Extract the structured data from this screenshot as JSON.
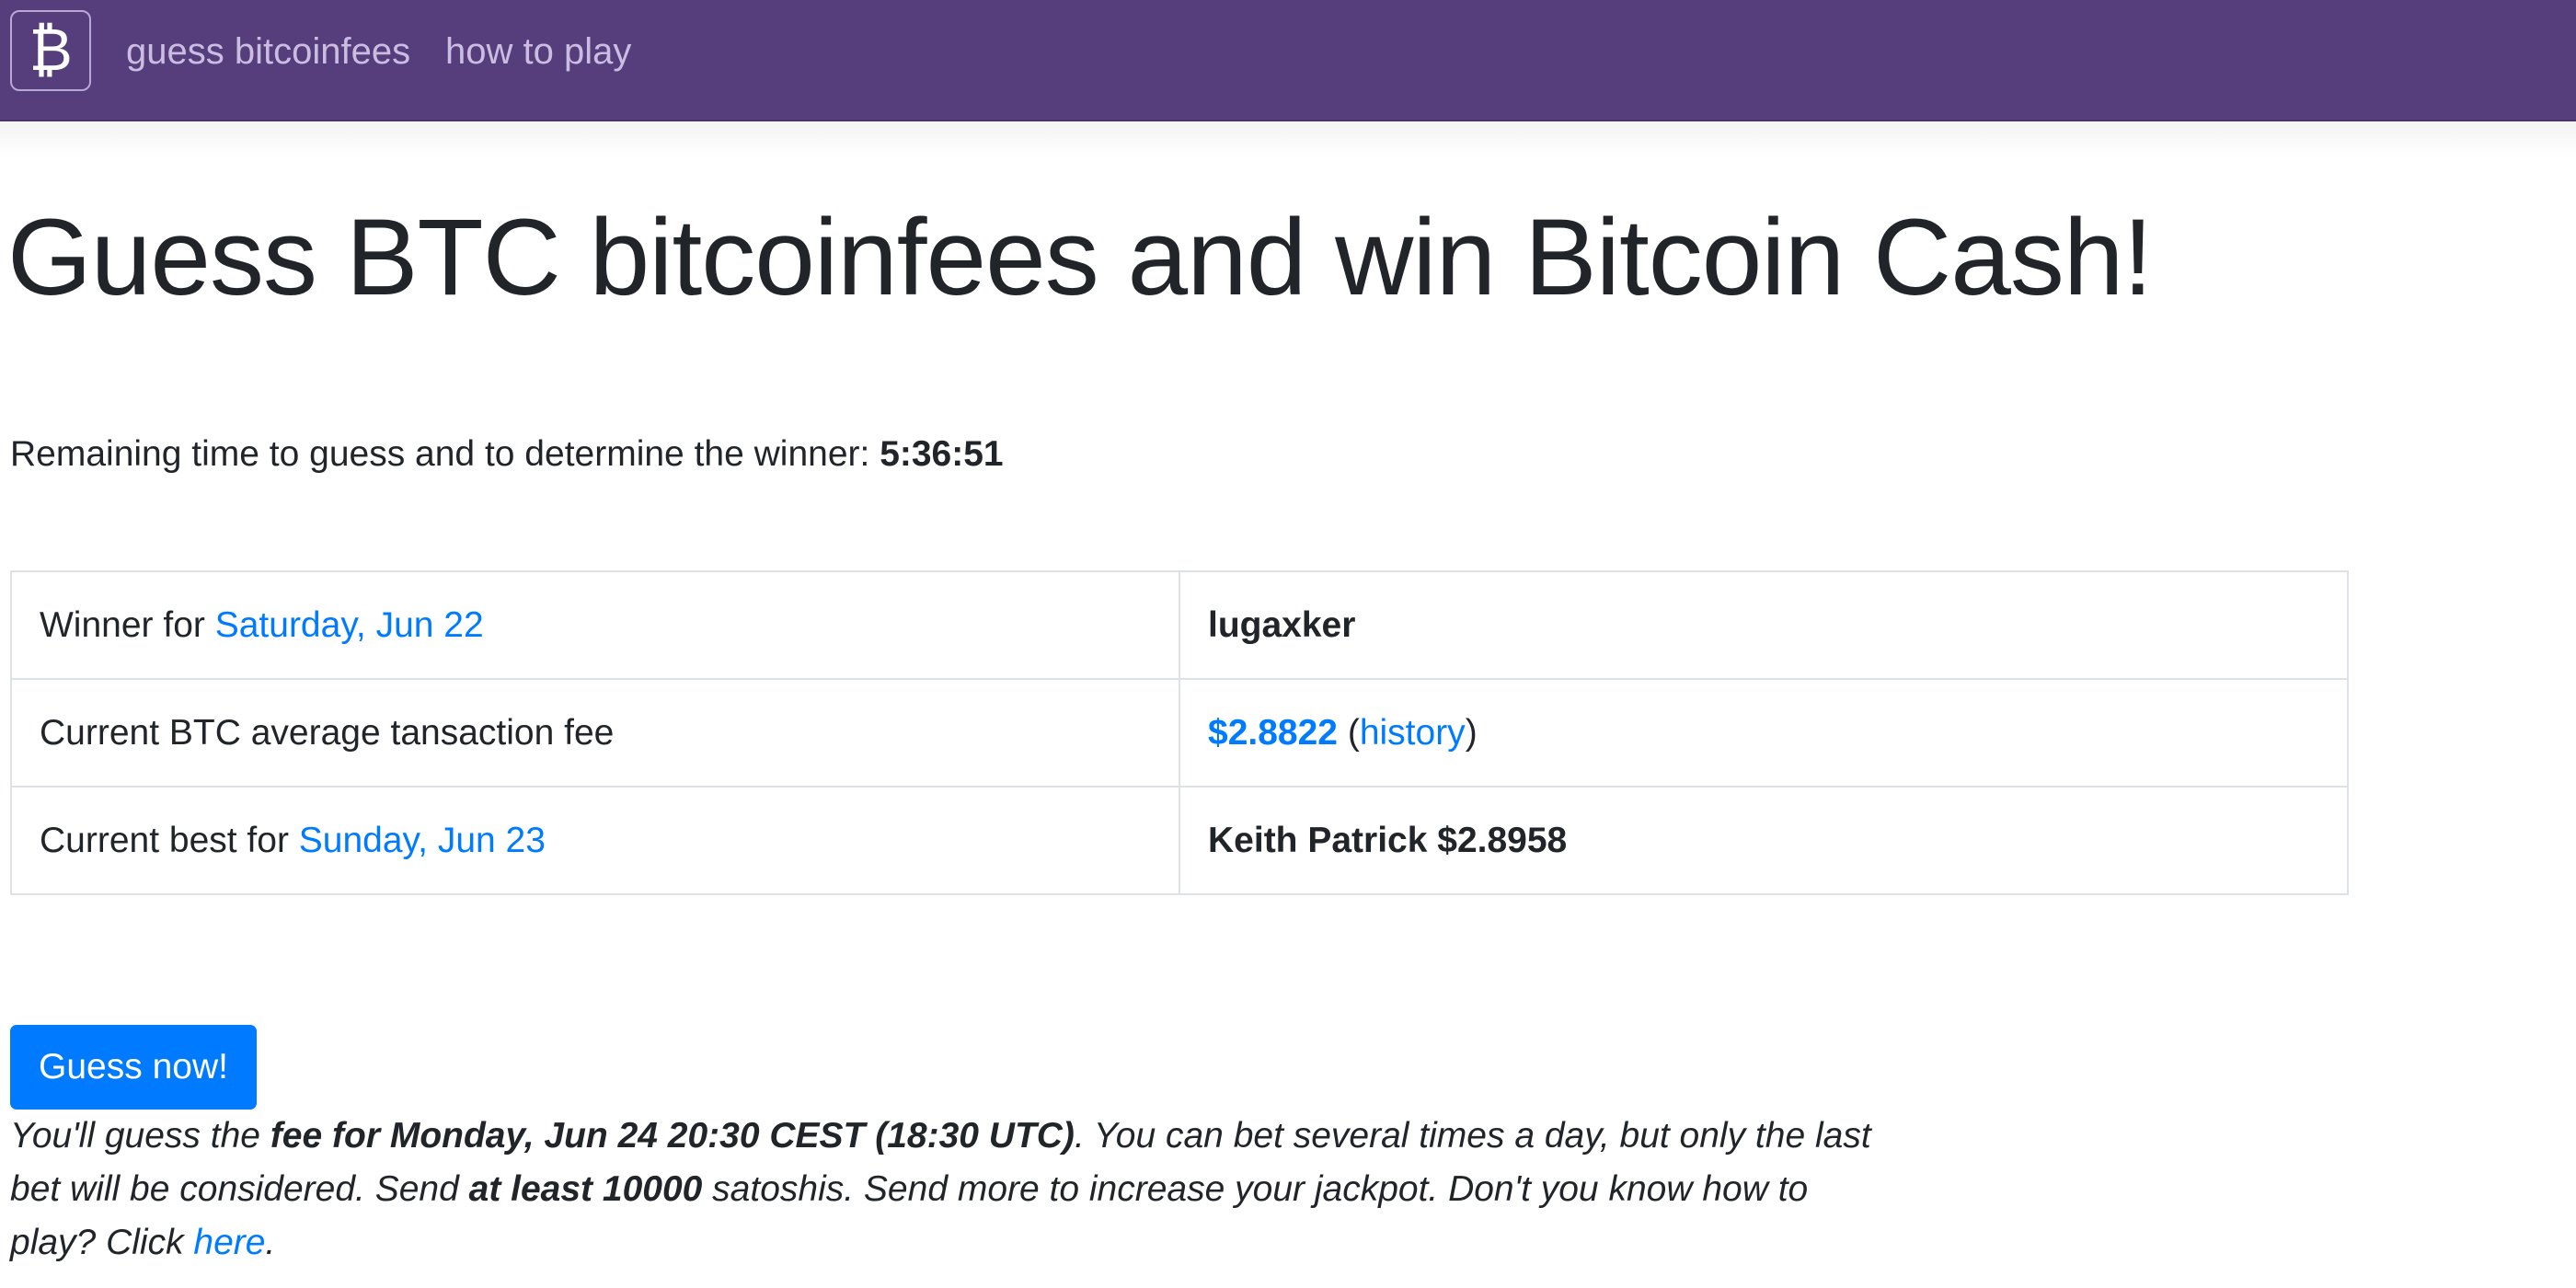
{
  "nav": {
    "brand_icon": "bitcoin-icon",
    "brand_glyph": "₿",
    "links": [
      {
        "label": "guess bitcoinfees"
      },
      {
        "label": "how to play"
      }
    ]
  },
  "colors": {
    "navbar": "#563d7c",
    "link": "#007bff",
    "button": "#007bff"
  },
  "main": {
    "title": "Guess BTC bitcoinfees and win Bitcoin Cash!",
    "timer": {
      "label": "Remaining time to guess and to determine the winner: ",
      "value": "5:36:51"
    },
    "table": {
      "rows": [
        {
          "label": "Winner for ",
          "label_link": "Saturday, Jun 22",
          "value": "lugaxker"
        },
        {
          "label": "Current BTC average tansaction fee",
          "value_link": "$2.8822",
          "open_paren": " (",
          "history_link": "history",
          "close_paren": ")"
        },
        {
          "label": "Current best for ",
          "label_link": "Sunday, Jun 23",
          "value": "Keith Patrick $2.8958"
        }
      ]
    },
    "guess_button": "Guess now!",
    "note": {
      "part1": "You'll guess the ",
      "bold1": "fee for Monday, Jun 24 20:30 CEST (18:30 UTC)",
      "part2": ". You can bet several times a day, but only the last bet will be considered. Send ",
      "bold2": "at least 10000",
      "part3": " satoshis. Send more to increase your jackpot. Don't you know how to play? Click ",
      "link": "here",
      "part4": "."
    }
  }
}
